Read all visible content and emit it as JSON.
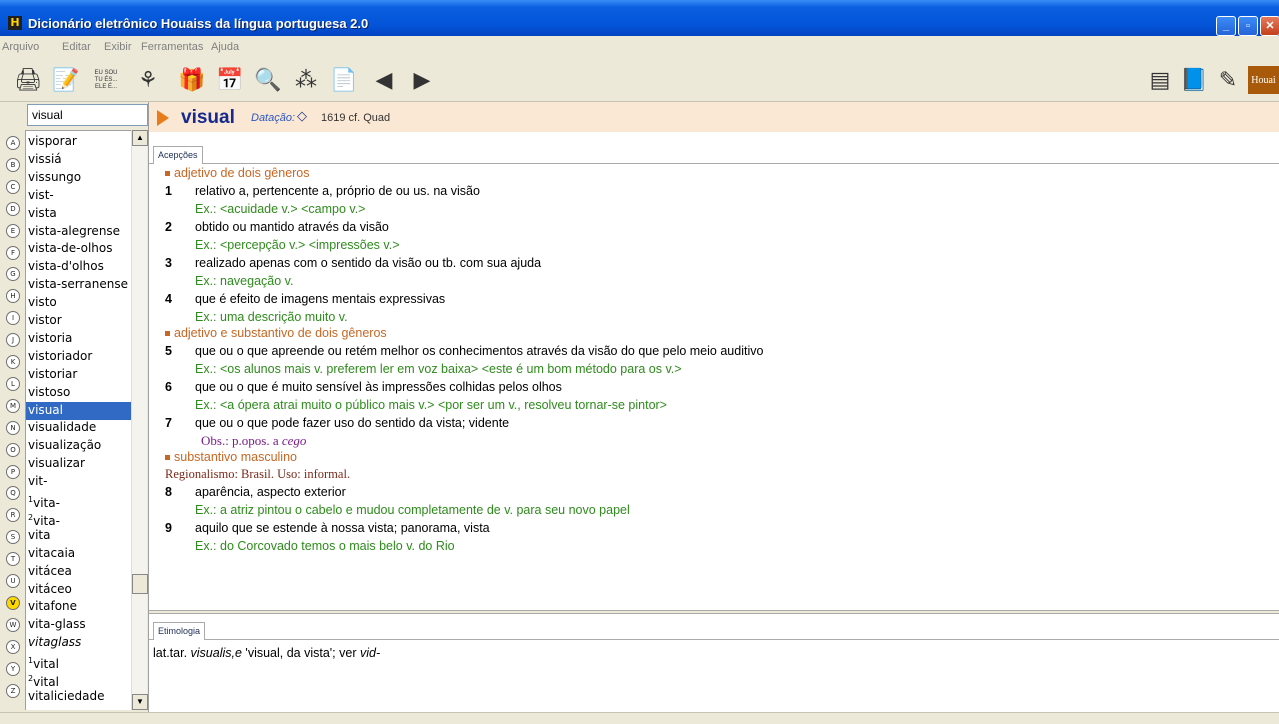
{
  "window": {
    "title": "Dicionário eletrônico Houaiss da língua portuguesa 2.0",
    "app_icon": "H"
  },
  "menu": [
    "Arquivo",
    "Editar",
    "Exibir",
    "Ferramentas",
    "Ajuda"
  ],
  "toolbar": {
    "conjugation_label_line1": "EU SOU",
    "conjugation_label_line2": "TU ÉS...",
    "conjugation_label_line3": "ELE É...",
    "brand_label": "Houai"
  },
  "search": {
    "value": "visual"
  },
  "alphabet": [
    "A",
    "B",
    "C",
    "D",
    "E",
    "F",
    "G",
    "H",
    "I",
    "J",
    "K",
    "L",
    "M",
    "N",
    "O",
    "P",
    "Q",
    "R",
    "S",
    "T",
    "U",
    "V",
    "W",
    "X",
    "Y",
    "Z"
  ],
  "alphabet_active": "V",
  "word_list": [
    {
      "word": "visporar",
      "sup": ""
    },
    {
      "word": "vissiá",
      "sup": ""
    },
    {
      "word": "vissungo",
      "sup": ""
    },
    {
      "word": "vist-",
      "sup": ""
    },
    {
      "word": "vista",
      "sup": ""
    },
    {
      "word": "vista-alegrense",
      "sup": ""
    },
    {
      "word": "vista-de-olhos",
      "sup": ""
    },
    {
      "word": "vista-d'olhos",
      "sup": ""
    },
    {
      "word": "vista-serranense",
      "sup": ""
    },
    {
      "word": "visto",
      "sup": ""
    },
    {
      "word": "vistor",
      "sup": ""
    },
    {
      "word": "vistoria",
      "sup": ""
    },
    {
      "word": "vistoriador",
      "sup": ""
    },
    {
      "word": "vistoriar",
      "sup": ""
    },
    {
      "word": "vistoso",
      "sup": ""
    },
    {
      "word": "visual",
      "sup": "",
      "selected": true
    },
    {
      "word": "visualidade",
      "sup": ""
    },
    {
      "word": "visualização",
      "sup": ""
    },
    {
      "word": "visualizar",
      "sup": ""
    },
    {
      "word": "vit-",
      "sup": ""
    },
    {
      "word": "vita-",
      "sup": "1"
    },
    {
      "word": "vita-",
      "sup": "2"
    },
    {
      "word": "vita",
      "sup": ""
    },
    {
      "word": "vitacaia",
      "sup": ""
    },
    {
      "word": "vitácea",
      "sup": ""
    },
    {
      "word": "vitáceo",
      "sup": ""
    },
    {
      "word": "vitafone",
      "sup": ""
    },
    {
      "word": "vita-glass",
      "sup": ""
    },
    {
      "word": "vitaglass",
      "sup": "",
      "italic": true
    },
    {
      "word": "vital",
      "sup": "1"
    },
    {
      "word": "vital",
      "sup": "2"
    },
    {
      "word": "vitaliciedade",
      "sup": ""
    }
  ],
  "entry": {
    "headword": "visual",
    "datacao_label": "Datação:",
    "datacao_value": "1619 cf. Quad",
    "tab_acepcoes": "Acepções",
    "tab_etimologia": "Etimologia",
    "pos1": "adjetivo de dois gêneros",
    "s1_num": "1",
    "s1_text": "relativo a, pertencente a, próprio de ou us. na visão",
    "s1_ex": "Ex.: <acuidade v.> <campo v.>",
    "s2_num": "2",
    "s2_text": "obtido ou mantido através da visão",
    "s2_ex": "Ex.: <percepção v.> <impressões v.>",
    "s3_num": "3",
    "s3_text": "realizado apenas com o sentido da visão ou tb. com sua ajuda",
    "s3_ex": "Ex.: navegação v.",
    "s4_num": "4",
    "s4_text": "que é efeito de imagens mentais expressivas",
    "s4_ex": "Ex.: uma descrição muito v.",
    "pos2": "adjetivo e substantivo de dois gêneros",
    "s5_num": "5",
    "s5_text": "que ou o que apreende ou retém melhor os conhecimentos através da visão do que pelo meio auditivo",
    "s5_ex": "Ex.: <os alunos mais v. preferem ler em voz baixa> <este é um bom método para os v.>",
    "s6_num": "6",
    "s6_text": "que ou o que é muito sensível às impressões colhidas pelos olhos",
    "s6_ex": "Ex.: <a ópera atrai muito o público mais v.> <por ser um v., resolveu tornar-se pintor>",
    "s7_num": "7",
    "s7_text": "que ou o que pode fazer uso do sentido da vista; vidente",
    "obs_prefix": "Obs.: p.opos. a ",
    "obs_word": "cego",
    "pos3": "substantivo masculino",
    "regional": "Regionalismo: Brasil. Uso: informal.",
    "s8_num": "8",
    "s8_text": "aparência, aspecto exterior",
    "s8_ex": "Ex.: a atriz pintou o cabelo e mudou completamente de v. para seu novo papel",
    "s9_num": "9",
    "s9_text": "aquilo que se estende à nossa vista; panorama, vista",
    "s9_ex": "Ex.: do Corcovado temos o mais belo v. do Rio",
    "etym_prefix": "lat.tar. ",
    "etym_latin": "visualis,e",
    "etym_middle": " 'visual, da vista'; ver ",
    "etym_ref": "vid-"
  }
}
